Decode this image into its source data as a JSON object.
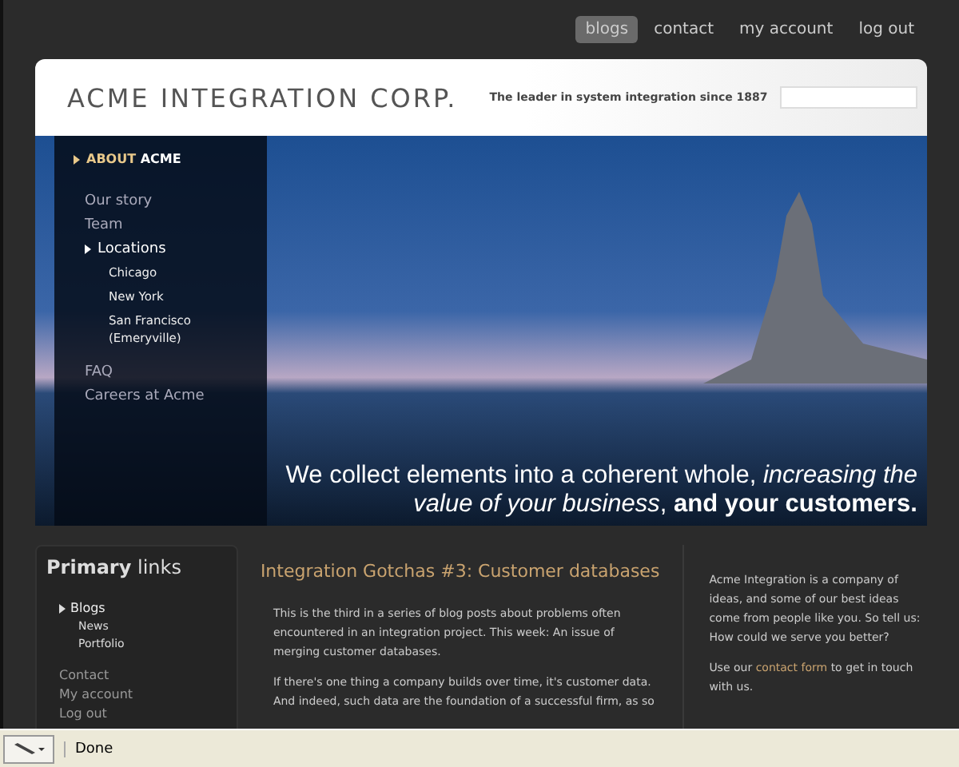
{
  "top_nav": [
    {
      "label": "blogs",
      "selected": true
    },
    {
      "label": "contact",
      "selected": false
    },
    {
      "label": "my account",
      "selected": false
    },
    {
      "label": "log out",
      "selected": false
    }
  ],
  "header": {
    "logo_text": "ACME INTEGRATION CORP.",
    "tagline": "The leader in system integration since 1887"
  },
  "hero": {
    "section_title_prefix": "ABOUT",
    "section_title": "ACME",
    "nav": [
      {
        "label": "Our story",
        "selected": false
      },
      {
        "label": "Team",
        "selected": false
      },
      {
        "label": "Locations",
        "selected": true,
        "children": [
          {
            "label": "Chicago"
          },
          {
            "label": "New York"
          },
          {
            "label": "San Francisco (Emeryville)"
          }
        ]
      },
      {
        "label": "FAQ",
        "selected": false
      },
      {
        "label": "Careers at Acme",
        "selected": false
      }
    ],
    "slogan": "We collect elements into a coherent whole, *increasing the value of your business*, **and your customers.**"
  },
  "primary_links": {
    "title_bold": "Primary",
    "title_rest": "links",
    "items": [
      {
        "label": "Blogs",
        "selected": true,
        "children": [
          {
            "label": "News"
          },
          {
            "label": "Portfolio"
          }
        ]
      },
      {
        "label": "Contact",
        "selected": false
      },
      {
        "label": "My account",
        "selected": false
      },
      {
        "label": "Log out",
        "selected": false
      }
    ]
  },
  "article": {
    "title": "Integration Gotchas #3: Customer databases",
    "paragraphs": [
      "This is the third in a series of blog posts about problems often encountered in an integration project. This week: An issue of merging customer databases.",
      "If there's one thing a company builds over time, it's customer data. And indeed, such data are the foundation of a successful firm, as so"
    ]
  },
  "aside": {
    "text": "Acme Integration is a company of ideas, and some of our best ideas come from people like you. So tell us: How could we serve you better?",
    "contact_before": "Use our",
    "contact_link": "contact form",
    "contact_after": "to get in touch with us."
  },
  "status_bar": {
    "text": "Done"
  }
}
